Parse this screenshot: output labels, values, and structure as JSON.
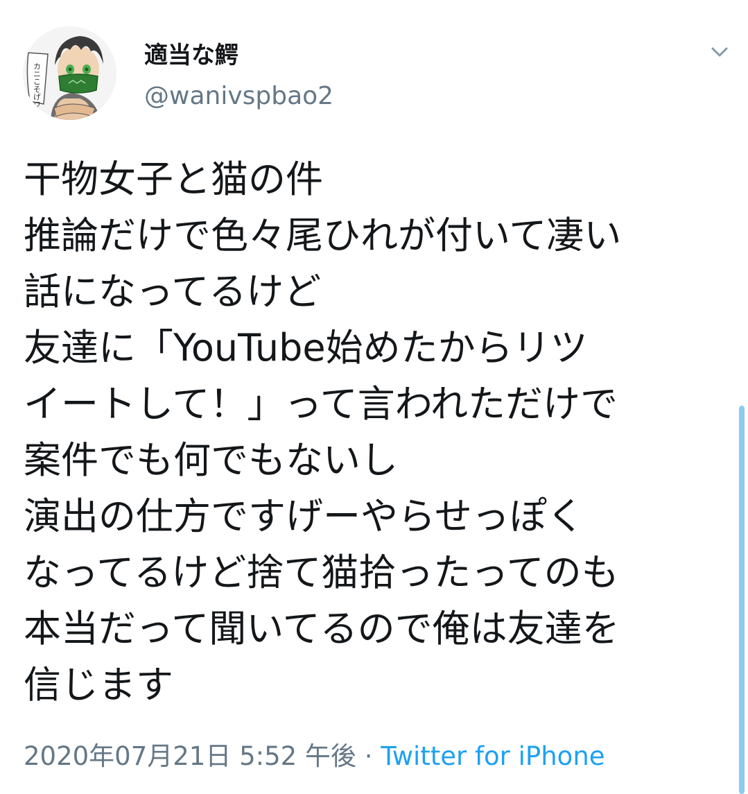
{
  "user": {
    "display_name": "適当な鰐",
    "handle": "@wanivspbao2",
    "avatar_caption": "カニこそげワー"
  },
  "tweet": {
    "lines": [
      "干物女子と猫の件",
      "推論だけで色々尾ひれが付いて凄い",
      "話になってるけど",
      "友達に「YouTube始めたからリツ",
      "イートして！」って言われただけで",
      "案件でも何でもないし",
      "演出の仕方ですげーやらせっぽく",
      "なってるけど捨て猫拾ったってのも",
      "本当だって聞いてるので俺は友達を",
      "信じます"
    ],
    "timestamp": "2020年07月21日 5:52 午後",
    "separator": " · ",
    "source": "Twitter for iPhone"
  },
  "icons": {
    "menu": "chevron-down-icon"
  },
  "colors": {
    "text": "#14171a",
    "secondary": "#657786",
    "link": "#1da1f2"
  }
}
